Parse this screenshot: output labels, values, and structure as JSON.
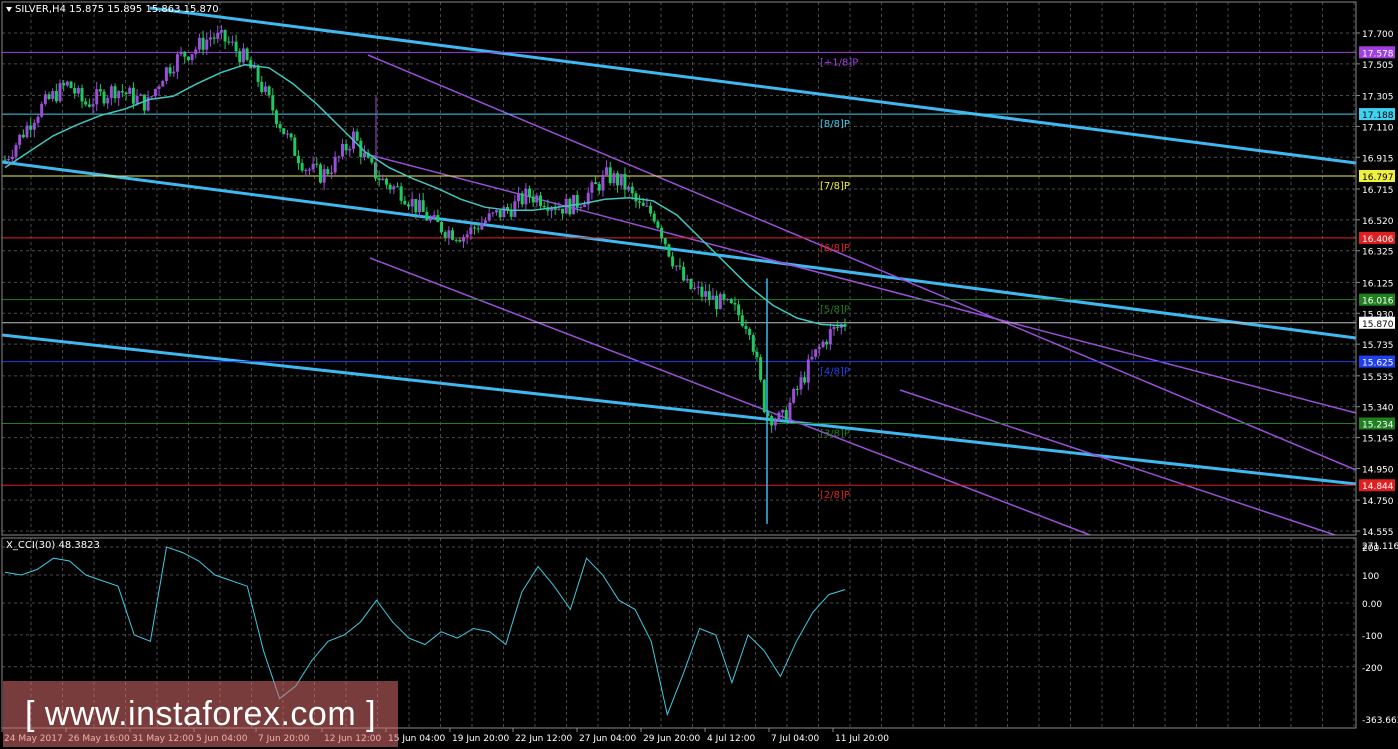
{
  "symbol_label": "SILVER,H4  15.875 15.895 15.863 15.870",
  "indicator_label": "X_CCI(30) 48.3823",
  "watermark": "[ www.instaforex.com ]",
  "colors": {
    "background": "#000000",
    "grid": "#4a4a4a",
    "channel": "#3fb8f0",
    "regression": "#9a4fd8",
    "ma": "#40c8c0",
    "bull_candle": "#9a4fd8",
    "bear_candle": "#20c860",
    "cci": "#40c8e0"
  },
  "chart_data": [
    {
      "type": "candlestick",
      "title": "SILVER,H4",
      "ohlc_current": {
        "open": 15.875,
        "high": 15.895,
        "low": 15.863,
        "close": 15.87
      },
      "ylim": [
        14.5,
        17.85
      ],
      "y_ticks": [
        "17.700",
        "17.505",
        "17.305",
        "17.110",
        "16.915",
        "16.715",
        "16.520",
        "16.325",
        "16.125",
        "15.930",
        "15.735",
        "15.535",
        "15.340",
        "15.145",
        "14.950",
        "14.750",
        "14.555"
      ],
      "x_ticks": [
        "24 May 2017",
        "26 May 16:00",
        "31 May 12:00",
        "5 Jun 04:00",
        "7 Jun 20:00",
        "12 Jun 12:00",
        "15 Jun 04:00",
        "19 Jun 20:00",
        "22 Jun 12:00",
        "27 Jun 04:00",
        "29 Jun 20:00",
        "4 Jul 12:00",
        "7 Jul 04:00",
        "11 Jul 20:00"
      ],
      "close_path": [
        16.9,
        17.05,
        17.2,
        17.3,
        17.38,
        17.25,
        17.3,
        17.35,
        17.3,
        17.25,
        17.45,
        17.55,
        17.6,
        17.68,
        17.65,
        17.55,
        17.4,
        17.2,
        17.0,
        16.85,
        16.8,
        16.9,
        17.05,
        16.85,
        16.75,
        16.7,
        16.6,
        16.5,
        16.45,
        16.42,
        16.5,
        16.55,
        16.6,
        16.68,
        16.65,
        16.6,
        16.62,
        16.7,
        16.8,
        16.75,
        16.6,
        16.55,
        16.3,
        16.1,
        16.05,
        16.0,
        15.95,
        15.85,
        15.3,
        15.25,
        15.45,
        15.65,
        15.8,
        15.87
      ],
      "ma_path": [
        16.85,
        16.95,
        17.05,
        17.12,
        17.18,
        17.22,
        17.28,
        17.3,
        17.38,
        17.45,
        17.5,
        17.48,
        17.38,
        17.25,
        17.1,
        16.95,
        16.85,
        16.78,
        16.72,
        16.65,
        16.6,
        16.58,
        16.58,
        16.6,
        16.62,
        16.65,
        16.66,
        16.64,
        16.55,
        16.4,
        16.25,
        16.1,
        15.98,
        15.9,
        15.86,
        15.85
      ],
      "levels": [
        {
          "label": "[+1/8]P",
          "price": "17.578",
          "value": 17.578,
          "color": "#a040e0"
        },
        {
          "label": "[8/8]P",
          "price": "17.188",
          "value": 17.188,
          "color": "#40d0f0"
        },
        {
          "label": "[7/8]P",
          "price": "16.797",
          "value": 16.797,
          "color": "#f0f040"
        },
        {
          "label": "[6/8]P",
          "price": "16.406",
          "value": 16.406,
          "color": "#e02020"
        },
        {
          "label": "[5/8]P",
          "price": "16.016",
          "value": 16.016,
          "color": "#208020"
        },
        {
          "label": "",
          "price": "15.870",
          "value": 15.87,
          "color": "#c0c0c0"
        },
        {
          "label": "[4/8]P",
          "price": "15.625",
          "value": 15.625,
          "color": "#2040f0"
        },
        {
          "label": "[3/8]P",
          "price": "15.234",
          "value": 15.234,
          "color": "#208020"
        },
        {
          "label": "[2/8]P",
          "price": "14.844",
          "value": 14.844,
          "color": "#e02020"
        }
      ]
    },
    {
      "type": "line",
      "title": "X_CCI(30) 48.3823",
      "ylim": [
        -363.663,
        271.1164
      ],
      "y_ticks": [
        "271.1164",
        "200",
        "100",
        "0.00",
        "-100",
        "-200",
        "-363.663"
      ],
      "values": [
        110,
        100,
        120,
        160,
        150,
        100,
        80,
        60,
        -100,
        -120,
        200,
        180,
        150,
        100,
        80,
        60,
        -150,
        -300,
        -260,
        -180,
        -120,
        -100,
        -60,
        10,
        -60,
        -110,
        -130,
        -90,
        -110,
        -80,
        -90,
        -130,
        40,
        130,
        60,
        -20,
        160,
        100,
        10,
        -20,
        -120,
        -350,
        -220,
        -80,
        -100,
        -250,
        -100,
        -150,
        -230,
        -120,
        -30,
        30,
        48
      ]
    }
  ]
}
